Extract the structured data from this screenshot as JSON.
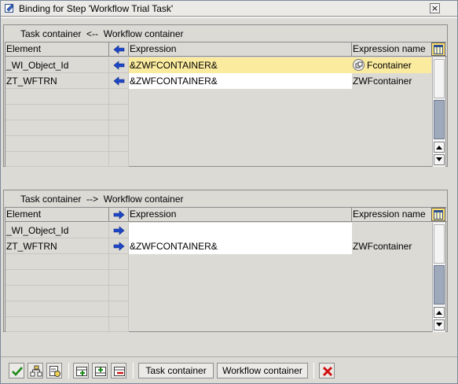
{
  "window": {
    "title": "Binding for Step 'Workflow Trial Task'",
    "close_glyph": "×"
  },
  "panel_top": {
    "title": "Task container  <--  Workflow container",
    "headers": {
      "element": "Element",
      "expression": "Expression",
      "expression_name": "Expression name"
    },
    "arrow_direction": "left",
    "rows": [
      {
        "element": "_WI_Object_Id",
        "expression": "&ZWFCONTAINER&",
        "expression_name": "Fcontainer",
        "highlighted": true
      },
      {
        "element": "ZT_WFTRN",
        "expression": "&ZWFCONTAINER&",
        "expression_name": "ZWFcontainer",
        "highlighted": false
      }
    ]
  },
  "panel_bottom": {
    "title": "Task container  -->  Workflow container",
    "headers": {
      "element": "Element",
      "expression": "Expression",
      "expression_name": "Expression name"
    },
    "arrow_direction": "right",
    "rows": [
      {
        "element": "_WI_Object_Id",
        "expression": "",
        "expression_name": "",
        "highlighted": false
      },
      {
        "element": "ZT_WFTRN",
        "expression": "&ZWFCONTAINER&",
        "expression_name": "ZWFcontainer",
        "highlighted": false
      }
    ]
  },
  "toolbar": {
    "task_container_label": "Task container",
    "workflow_container_label": "Workflow container",
    "icons": [
      "check-icon",
      "generate-binding-icon",
      "check-binding-icon",
      "insert-row-icon",
      "append-row-icon",
      "delete-row-icon",
      "cancel-icon"
    ]
  },
  "colors": {
    "highlight_row": "#fbeb9f",
    "arrow_blue": "#1e46c8",
    "cancel_red": "#d01010"
  }
}
